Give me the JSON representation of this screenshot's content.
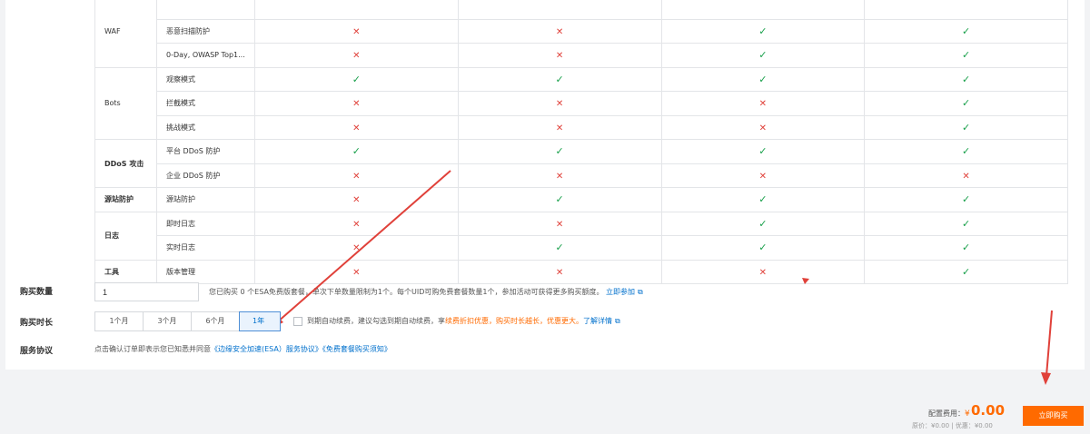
{
  "feature_table": {
    "groups": [
      {
        "category": "WAF",
        "bold": false,
        "rows": [
          {
            "feature": "",
            "marks": [
              "",
              "",
              "",
              ""
            ]
          },
          {
            "feature": "恶意扫描防护",
            "marks": [
              "no",
              "no",
              "yes",
              "yes"
            ]
          },
          {
            "feature": "0-Day, OWASP Top1...",
            "marks": [
              "no",
              "no",
              "yes",
              "yes"
            ]
          }
        ]
      },
      {
        "category": "Bots",
        "bold": false,
        "rows": [
          {
            "feature": "观察模式",
            "marks": [
              "yes",
              "yes",
              "yes",
              "yes"
            ]
          },
          {
            "feature": "拦截模式",
            "marks": [
              "no",
              "no",
              "no",
              "yes"
            ]
          },
          {
            "feature": "挑战模式",
            "marks": [
              "no",
              "no",
              "no",
              "yes"
            ]
          }
        ]
      },
      {
        "category": "DDoS 攻击",
        "bold": true,
        "rows": [
          {
            "feature": "平台 DDoS 防护",
            "marks": [
              "yes",
              "yes",
              "yes",
              "yes"
            ]
          },
          {
            "feature": "企业 DDoS 防护",
            "marks": [
              "no",
              "no",
              "no",
              "no"
            ]
          }
        ]
      },
      {
        "category": "源站防护",
        "bold": true,
        "rows": [
          {
            "feature": "源站防护",
            "marks": [
              "no",
              "yes",
              "yes",
              "yes"
            ]
          }
        ]
      },
      {
        "category": "日志",
        "bold": true,
        "rows": [
          {
            "feature": "即时日志",
            "marks": [
              "no",
              "no",
              "yes",
              "yes"
            ]
          },
          {
            "feature": "实时日志",
            "marks": [
              "no",
              "yes",
              "yes",
              "yes"
            ]
          }
        ]
      },
      {
        "category": "工具",
        "bold": true,
        "rows": [
          {
            "feature": "版本管理",
            "marks": [
              "no",
              "no",
              "no",
              "yes"
            ]
          }
        ]
      }
    ]
  },
  "form": {
    "quantity_label": "购买数量",
    "quantity_value": "1",
    "quantity_hint": "您已购买 0 个ESA免费版套餐，单次下单数量限制为1个。每个UID可购免费套餐数量1个，参加活动可获得更多购买额度。",
    "quantity_link": "立即参加",
    "duration_label": "购买时长",
    "durations": [
      "1个月",
      "3个月",
      "6个月",
      "1年"
    ],
    "duration_selected": "1年",
    "auto_renew_text": "到期自动续费，建议勾选到期自动续费，享",
    "auto_renew_highlight": "续费折扣优惠，购买时长越长，优惠更大。",
    "auto_renew_link": "了解详情",
    "service_label": "服务协议",
    "agreement_prefix": "点击确认订单即表示您已知悉并同意",
    "agreement_link1": "《边缘安全加速(ESA）服务协议》",
    "agreement_link2": "《免费套餐购买须知》"
  },
  "footer": {
    "fee_label": "配置费用：",
    "currency": "¥",
    "fee_amount": "0.00",
    "fee_sub": "原价：¥0.00 | 优惠：¥0.00",
    "buy_button": "立即购买"
  },
  "colors": {
    "accent": "#ff6a00",
    "link": "#0070cc",
    "check": "#19a04b",
    "cross": "#e0413a",
    "annotation_arrow": "#e0413a"
  },
  "icons": {
    "yes": "check-icon",
    "no": "cross-icon",
    "external": "external-link-icon"
  }
}
